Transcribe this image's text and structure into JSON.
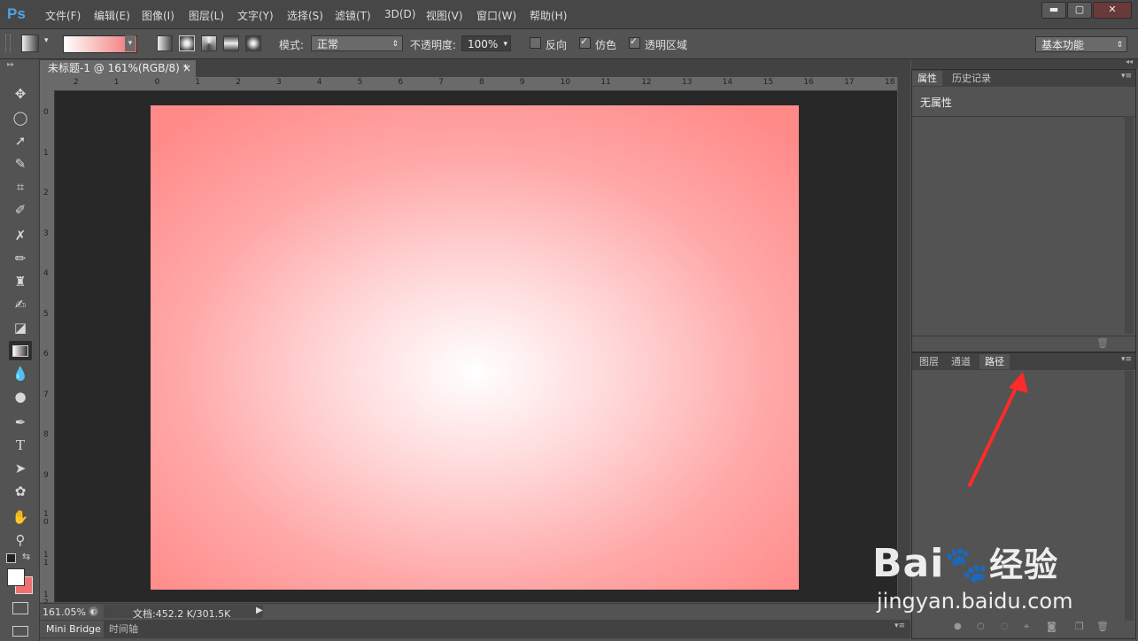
{
  "app": {
    "logo": "Ps"
  },
  "menu": [
    "文件(F)",
    "编辑(E)",
    "图像(I)",
    "图层(L)",
    "文字(Y)",
    "选择(S)",
    "滤镜(T)",
    "3D(D)",
    "视图(V)",
    "窗口(W)",
    "帮助(H)"
  ],
  "window_controls": {
    "minimize": "▬",
    "maximize": "▢",
    "close": "✕"
  },
  "options": {
    "mode_label": "模式:",
    "mode_value": "正常",
    "opacity_label": "不透明度:",
    "opacity_value": "100%",
    "reverse": "反向",
    "dither": "仿色",
    "transparency": "透明区域",
    "workspace": "基本功能",
    "gradient_start": "#ffffff",
    "gradient_end": "#f07070"
  },
  "document": {
    "tab_title": "未标题-1 @ 161%(RGB/8) *",
    "tab_close": "×",
    "ruler_top": [
      "2",
      "1",
      "0",
      "1",
      "2",
      "3",
      "4",
      "5",
      "6",
      "7",
      "8",
      "9",
      "10",
      "11",
      "12",
      "13",
      "14",
      "15",
      "16",
      "17",
      "18"
    ],
    "ruler_left": [
      "0",
      "1",
      "2",
      "3",
      "4",
      "5",
      "6",
      "7",
      "8",
      "9",
      "10",
      "11",
      "12"
    ],
    "gradient_center": "#ffffff",
    "gradient_edge": "#ff8a88"
  },
  "status": {
    "zoom": "161.05%",
    "doc_info": "文档:452.2 K/301.5K"
  },
  "bottom_tabs": [
    "Mini Bridge",
    "时间轴"
  ],
  "properties_panel": {
    "tabs": [
      "属性",
      "历史记录"
    ],
    "content": "无属性"
  },
  "layers_panel": {
    "tabs": [
      "图层",
      "通道",
      "路径"
    ]
  },
  "annotation_color": "#ff2a2a",
  "watermark": {
    "brand": "Bai",
    "suffix": "经验",
    "url": "jingyan.baidu.com"
  }
}
